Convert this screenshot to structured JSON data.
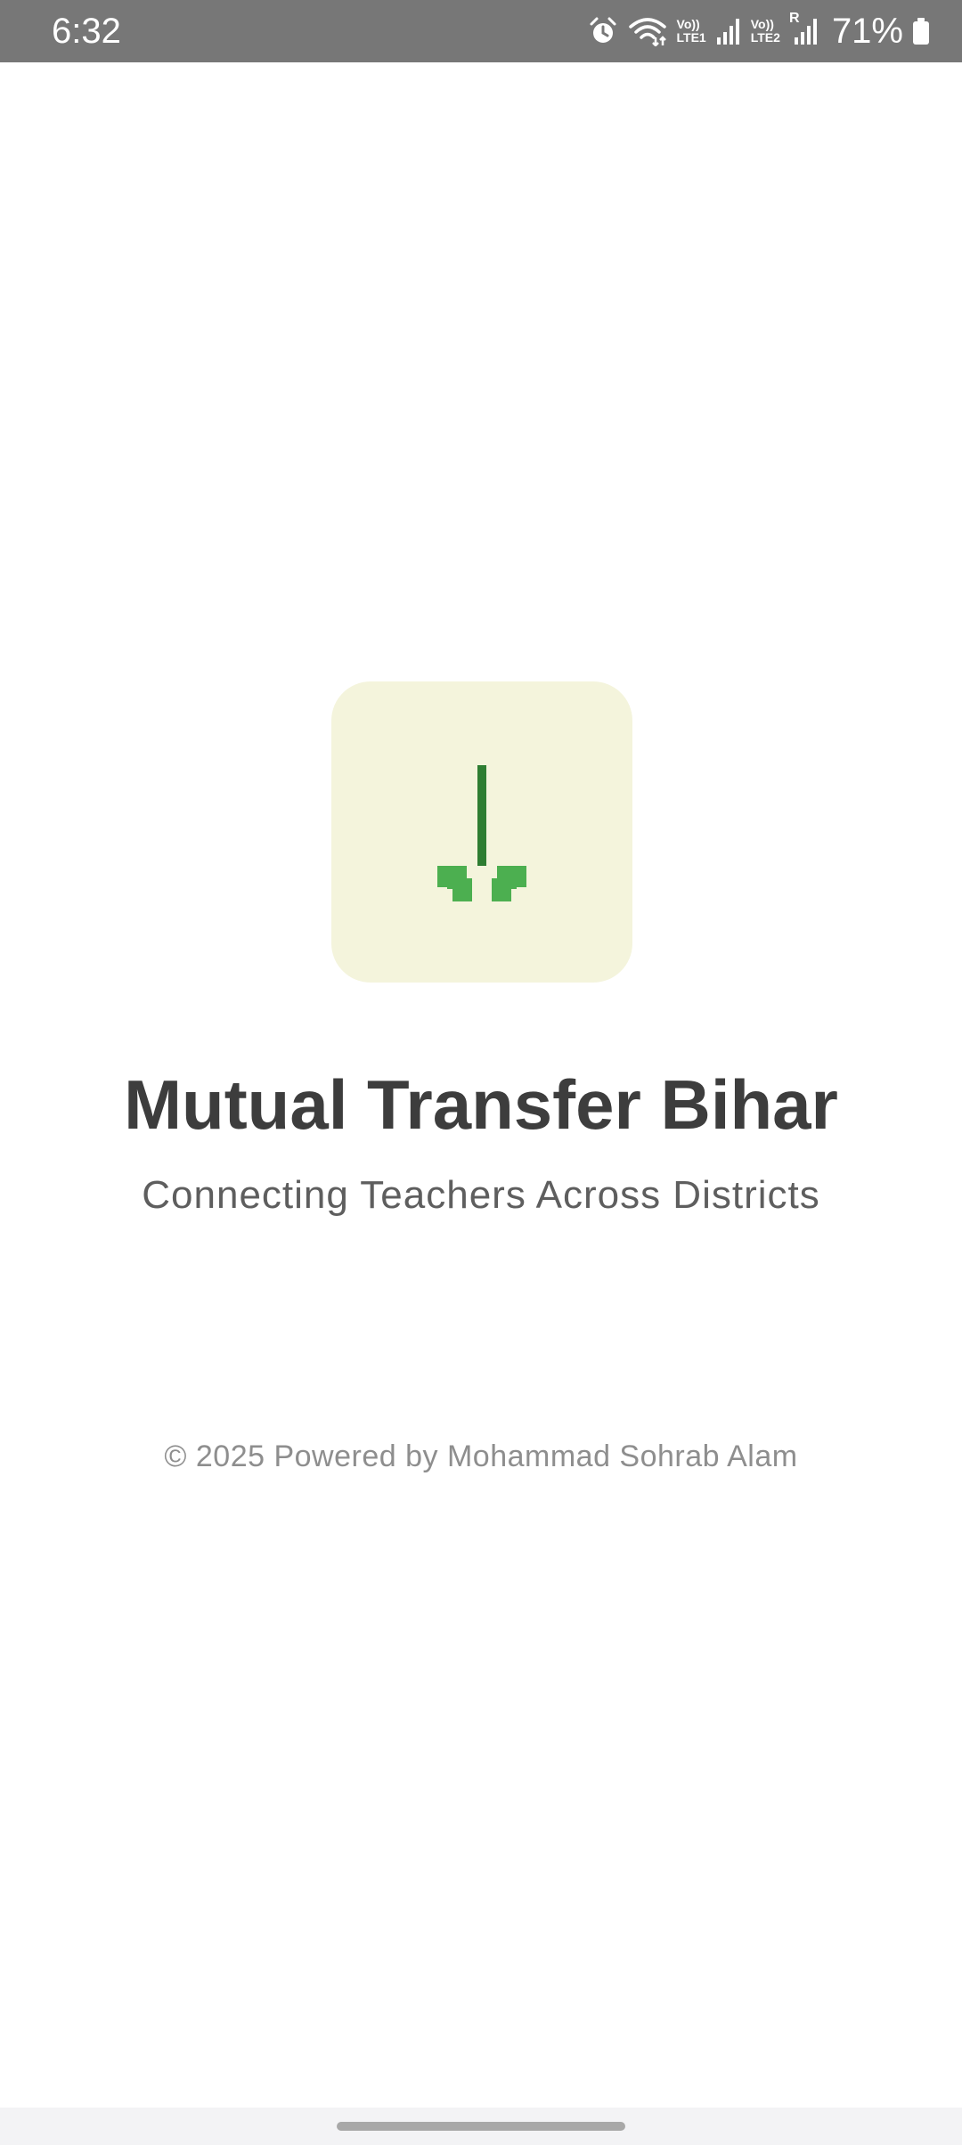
{
  "status_bar": {
    "time": "6:32",
    "net1_top": "Vo))",
    "net1_bottom": "LTE1",
    "net2_top": "Vo))",
    "net2_bottom": "LTE2",
    "roaming": "R",
    "battery": "71%",
    "icons": [
      "alarm-icon",
      "wifi-icon",
      "signal-icon",
      "signal-icon",
      "battery-icon"
    ]
  },
  "splash": {
    "title": "Mutual Transfer Bihar",
    "subtitle": "Connecting Teachers Across Districts",
    "copyright": "© 2025 Powered by Mohammad Sohrab Alam",
    "logo_icon": "seedling-icon"
  },
  "colors": {
    "status_bar_bg": "#777777",
    "logo_bg": "#f4f4dc",
    "stem_green": "#2e7d32",
    "leaf_green": "#4caf50",
    "title": "#3d3d3d",
    "subtitle": "#5e5e5e",
    "footer_text": "#8e8e8e"
  }
}
